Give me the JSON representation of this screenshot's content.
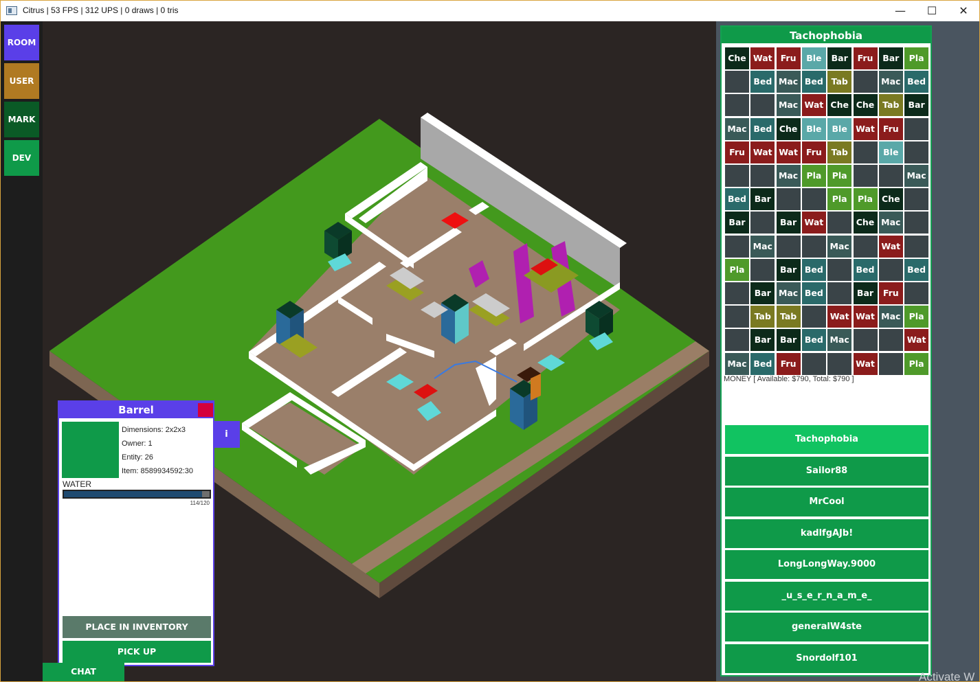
{
  "window": {
    "title": "Citrus | 53 FPS | 312 UPS | 0 draws | 0 tris",
    "minimize": "—",
    "maximize": "☐",
    "close": "✕"
  },
  "nav": [
    {
      "label": "ROOM",
      "color": "#5a3fe8"
    },
    {
      "label": "USER",
      "color": "#b07a22"
    },
    {
      "label": "MARK",
      "color": "#0a5a26"
    },
    {
      "label": "DEV",
      "color": "#0f9a49"
    }
  ],
  "inventory": {
    "title": "Tachophobia",
    "colors": {
      "Che": "#0c2a1a",
      "Wat": "#8b1c1c",
      "Fru": "#8b1c1c",
      "Ble": "#5aa8a8",
      "Bar": "#0c2a1a",
      "Pla": "#4f9a2a",
      "Bed": "#2a6a6a",
      "Mac": "#3a5a58",
      "Tab": "#7a7a22",
      "": "#3a4448"
    },
    "grid": [
      [
        "Che",
        "Wat",
        "Fru",
        "Ble",
        "Bar",
        "Fru",
        "Bar",
        "Pla"
      ],
      [
        "",
        "Bed",
        "Mac",
        "Bed",
        "Tab",
        "",
        "Mac",
        "Bed"
      ],
      [
        "",
        "",
        "Mac",
        "Wat",
        "Che",
        "Che",
        "Tab",
        "Bar"
      ],
      [
        "Mac",
        "Bed",
        "Che",
        "Ble",
        "Ble",
        "Wat",
        "Fru",
        ""
      ],
      [
        "Fru",
        "Wat",
        "Wat",
        "Fru",
        "Tab",
        "",
        "Ble",
        ""
      ],
      [
        "",
        "",
        "Mac",
        "Pla",
        "Pla",
        "",
        "",
        "Mac"
      ],
      [
        "Bed",
        "Bar",
        "",
        "",
        "Pla",
        "Pla",
        "Che",
        ""
      ],
      [
        "Bar",
        "",
        "Bar",
        "Wat",
        "",
        "Che",
        "Mac",
        ""
      ],
      [
        "",
        "Mac",
        "",
        "",
        "Mac",
        "",
        "Wat",
        ""
      ],
      [
        "Pla",
        "",
        "Bar",
        "Bed",
        "",
        "Bed",
        "",
        "Bed"
      ],
      [
        "",
        "Bar",
        "Mac",
        "Bed",
        "",
        "Bar",
        "Fru",
        ""
      ],
      [
        "",
        "Tab",
        "Tab",
        "",
        "Wat",
        "Wat",
        "Mac",
        "Pla"
      ],
      [
        "",
        "Bar",
        "Bar",
        "Bed",
        "Mac",
        "",
        "",
        "Wat"
      ],
      [
        "Mac",
        "Bed",
        "Fru",
        "",
        "",
        "Wat",
        "",
        "Pla"
      ]
    ],
    "money": "MONEY [ Available: $790, Total: $790 ]"
  },
  "players": [
    "Tachophobia",
    "Sailor88",
    "MrCool",
    "kadlfgAJb!",
    "LongLongWay.9000",
    "_u_s_e_r_n_a_m_e_",
    "generalW4ste",
    "Snordolf101"
  ],
  "info": {
    "title": "Barrel",
    "dimensions": "Dimensions: 2x2x3",
    "owner": "Owner: 1",
    "entity": "Entity: 26",
    "item": "Item: 8589934592:30",
    "water_label": "WATER",
    "water_value": 114,
    "water_max": 120,
    "water_text": "114/120",
    "place_btn": "PLACE IN INVENTORY",
    "pickup_btn": "PICK UP",
    "info_btn": "i"
  },
  "chat": "CHAT",
  "watermark": "Activate W"
}
